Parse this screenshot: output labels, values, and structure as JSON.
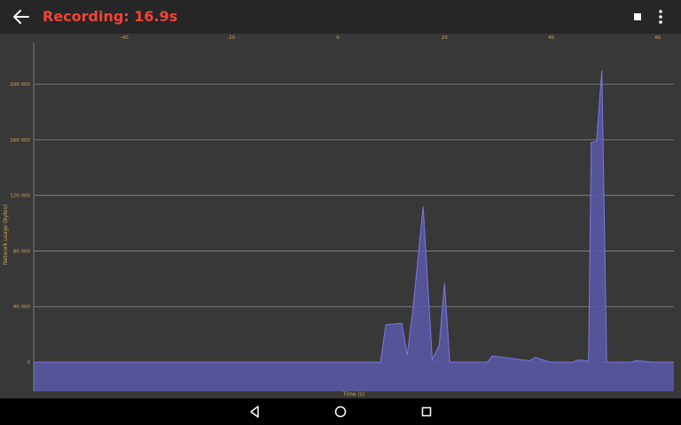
{
  "app_bar": {
    "title": "Recording: 16.9s",
    "back_icon": "arrow-left-icon",
    "stop_icon": "stop-icon",
    "more_icon": "more-vertical-icon"
  },
  "colors": {
    "title": "#f44336",
    "axis_text": "#d2a54a",
    "area_fill": "#5a58a4",
    "line": "#7a78e0",
    "background": "#383838",
    "bar": "#262626"
  },
  "chart_data": {
    "type": "area",
    "xlabel": "Time (s)",
    "ylabel": "Network usage (bytes)",
    "x_ticks": [
      "-40",
      "-20",
      "0",
      "20",
      "40",
      "60"
    ],
    "y_ticks": [
      "0",
      "40 000",
      "80 000",
      "120 000",
      "160 000",
      "200 000"
    ],
    "xlim": [
      -57,
      63
    ],
    "ylim": [
      -21000,
      230000
    ],
    "grid": true,
    "series": [
      {
        "x": [
          -57,
          8,
          9,
          12,
          13,
          14,
          16,
          17.7,
          19,
          20,
          21,
          28,
          29,
          36,
          37,
          39,
          40,
          44,
          45,
          47,
          47.5,
          48.5,
          49.5,
          50.4,
          55,
          56,
          59,
          63
        ],
        "y": [
          0,
          0,
          27000,
          28000,
          5000,
          35000,
          112000,
          2000,
          12000,
          57000,
          0,
          0,
          4500,
          1000,
          3500,
          1000,
          0,
          0,
          1500,
          800,
          158000,
          159000,
          210000,
          0,
          0,
          1200,
          0,
          0
        ]
      }
    ]
  },
  "nav_bar": {
    "back_icon": "triangle-back-icon",
    "home_icon": "circle-home-icon",
    "recents_icon": "square-recents-icon"
  }
}
